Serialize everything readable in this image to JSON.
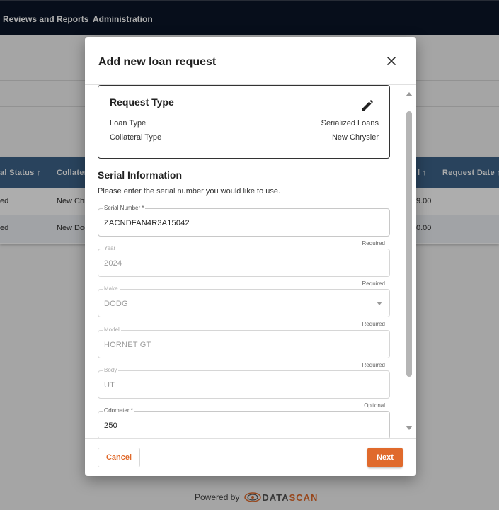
{
  "nav": {
    "items": [
      {
        "label": "Reviews and Reports"
      },
      {
        "label": "Administration"
      }
    ]
  },
  "table": {
    "headers": [
      "al Status ↑",
      "Collater",
      "l ↑",
      "Request Date ↑"
    ],
    "rows": [
      {
        "status": "ed",
        "collateral": "New Chr",
        "amount": "9.00"
      },
      {
        "status": "ed",
        "collateral": "New Doc",
        "amount": "0.00"
      }
    ]
  },
  "footer": {
    "powered_by": "Powered by",
    "brand_a": "DATA",
    "brand_b": "SCAN"
  },
  "modal": {
    "title": "Add new loan request",
    "request_type": {
      "title": "Request Type",
      "rows": [
        {
          "label": "Loan Type",
          "value": "Serialized Loans"
        },
        {
          "label": "Collateral Type",
          "value": "New Chrysler"
        }
      ]
    },
    "serial_info": {
      "title": "Serial Information",
      "description": "Please enter the serial number you would like to use."
    },
    "fields": {
      "serial": {
        "label": "Serial Number *",
        "value": "ZACNDFAN4R3A15042",
        "hint": "Required"
      },
      "year": {
        "label": "Year",
        "value": "2024",
        "hint": "Required"
      },
      "make": {
        "label": "Make",
        "value": "DODG",
        "hint": "Required"
      },
      "model": {
        "label": "Model",
        "value": "HORNET GT",
        "hint": "Required"
      },
      "body": {
        "label": "Body",
        "value": "UT",
        "hint": "Optional"
      },
      "odometer": {
        "label": "Odometer *",
        "value": "250"
      }
    },
    "buttons": {
      "cancel": "Cancel",
      "next": "Next"
    }
  },
  "colors": {
    "topbar": "#0b1628",
    "table_header": "#3d6489",
    "accent": "#e06a2c"
  }
}
